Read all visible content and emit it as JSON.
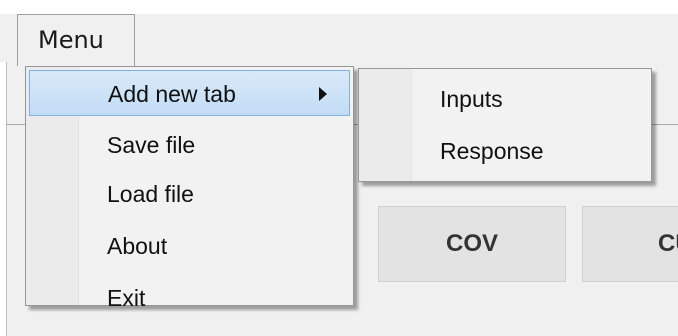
{
  "menubar": {
    "menu_label": "Menu"
  },
  "main_menu": {
    "items": [
      {
        "label": "Add new tab",
        "has_submenu": true,
        "highlighted": true
      },
      {
        "label": "Save file"
      },
      {
        "label": "Load file"
      },
      {
        "label": "About"
      },
      {
        "label": "Exit"
      }
    ]
  },
  "submenu": {
    "items": [
      {
        "label": "Inputs"
      },
      {
        "label": "Response"
      }
    ]
  },
  "tabs": [
    {
      "label": "COV"
    },
    {
      "label": "CUT"
    }
  ],
  "colors": {
    "highlight_fill": "#c8e1f7",
    "highlight_border": "#7fb2e4",
    "menu_background": "#f2f2f2"
  }
}
